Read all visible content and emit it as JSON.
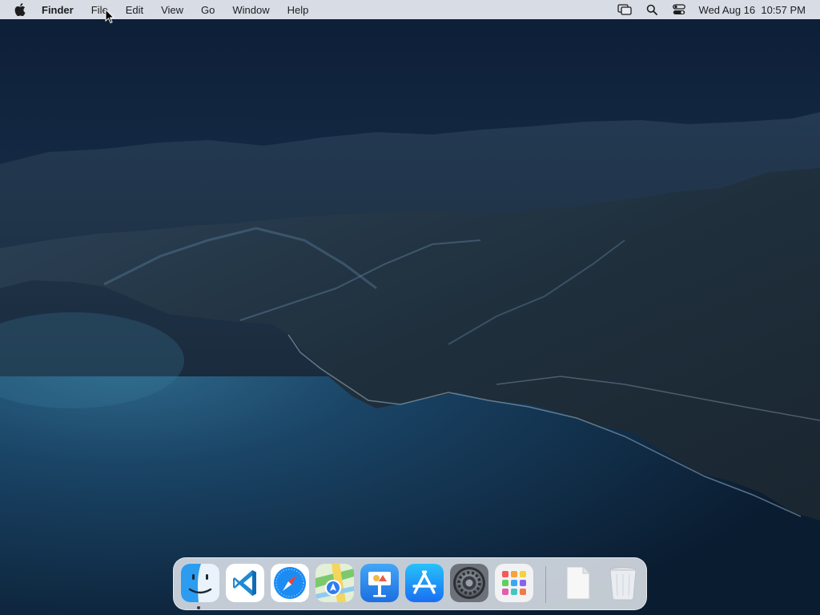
{
  "menubar": {
    "apple_icon": "apple-logo-icon",
    "app_name": "Finder",
    "items": [
      "File",
      "Edit",
      "View",
      "Go",
      "Window",
      "Help"
    ],
    "status_icons": [
      "screen-mirroring-icon",
      "spotlight-search-icon",
      "control-center-icon"
    ],
    "clock": "Wed Aug 16  10:57 PM"
  },
  "dock": {
    "apps": [
      {
        "name": "Finder",
        "icon": "finder-icon",
        "running": true
      },
      {
        "name": "Visual Studio Code",
        "icon": "vscode-icon",
        "running": false
      },
      {
        "name": "Safari",
        "icon": "safari-icon",
        "running": false
      },
      {
        "name": "Maps",
        "icon": "maps-icon",
        "running": false
      },
      {
        "name": "Keynote",
        "icon": "keynote-icon",
        "running": false
      },
      {
        "name": "App Store",
        "icon": "app-store-icon",
        "running": false
      },
      {
        "name": "System Settings",
        "icon": "system-settings-icon",
        "running": false
      },
      {
        "name": "Launchpad",
        "icon": "launchpad-icon",
        "running": false
      }
    ],
    "others": [
      {
        "name": "Document",
        "icon": "document-icon"
      },
      {
        "name": "Trash",
        "icon": "trash-icon"
      }
    ]
  },
  "colors": {
    "menubar_bg": "#e8ecf2",
    "dock_bg": "#eceff6",
    "wallpaper_sky": "#0f2340",
    "wallpaper_sea": "#12324f"
  }
}
